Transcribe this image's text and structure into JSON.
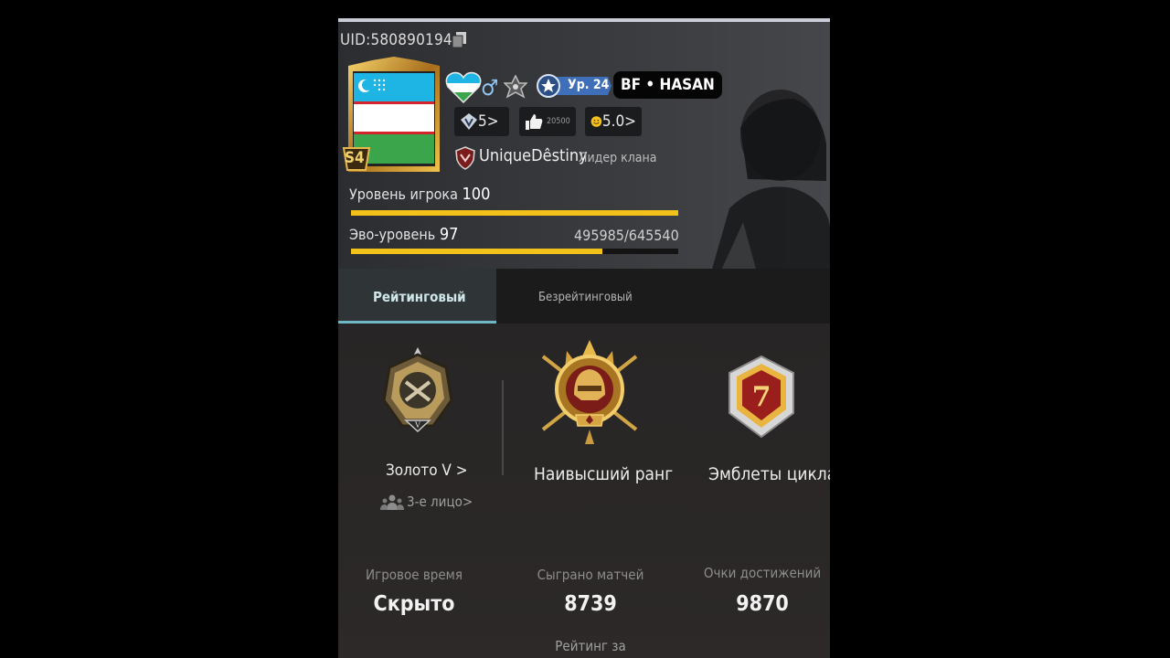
{
  "profile": {
    "uid": "UID:580890194",
    "season_badge": "S4",
    "level_badge": "Ур. 24",
    "player_name": "BF • HASAN",
    "popularity": "5>",
    "likes": "20500",
    "rating": "5.0>",
    "clan_name": "UniqueDêstiny",
    "clan_role": "Лидер клана",
    "gender_symbol": "♂",
    "player_level_label": "Уровень игрока",
    "player_level": "100",
    "player_level_progress": 1.0,
    "evo_level_label": "Эво-уровень",
    "evo_level": "97",
    "evo_xp": "495985/645540",
    "evo_progress": 0.768
  },
  "tabs": [
    {
      "label": "Рейтинговый",
      "active": true
    },
    {
      "label": "Безрейтинговый",
      "active": false
    }
  ],
  "ranks": {
    "current_rank": "Золото V >",
    "highest_rank_label": "Наивысший ранг",
    "cycle_emblems_label": "Эмблеты цикла",
    "cycle_number": "7",
    "tier_mark": "V",
    "view_mode": "3-е лицо>"
  },
  "stats": [
    {
      "label": "Игровое время",
      "value": "Скрыто"
    },
    {
      "label": "Сыграно матчей",
      "value": "8739"
    },
    {
      "label": "Очки достижений",
      "value": "9870"
    }
  ],
  "season_rating_label": "Рейтинг за",
  "icons": [
    "copy-icon",
    "avatar-frame",
    "heart-flag-icon",
    "male-icon",
    "clan-rank-icon",
    "level-star-icon",
    "diamond-v-icon",
    "thumbs-up-icon",
    "smiley-icon",
    "clan-logo-icon",
    "soldier-silhouette",
    "gold-rank-emblem",
    "highest-rank-emblem",
    "cycle-emblem",
    "team-icon"
  ],
  "colors": {
    "accent_gold": "#f2c21a",
    "tab_accent": "#6fb8c3",
    "level_blue": "#3e6fb8",
    "flag_blue": "#1eb5e5",
    "flag_green": "#3aa54a"
  }
}
